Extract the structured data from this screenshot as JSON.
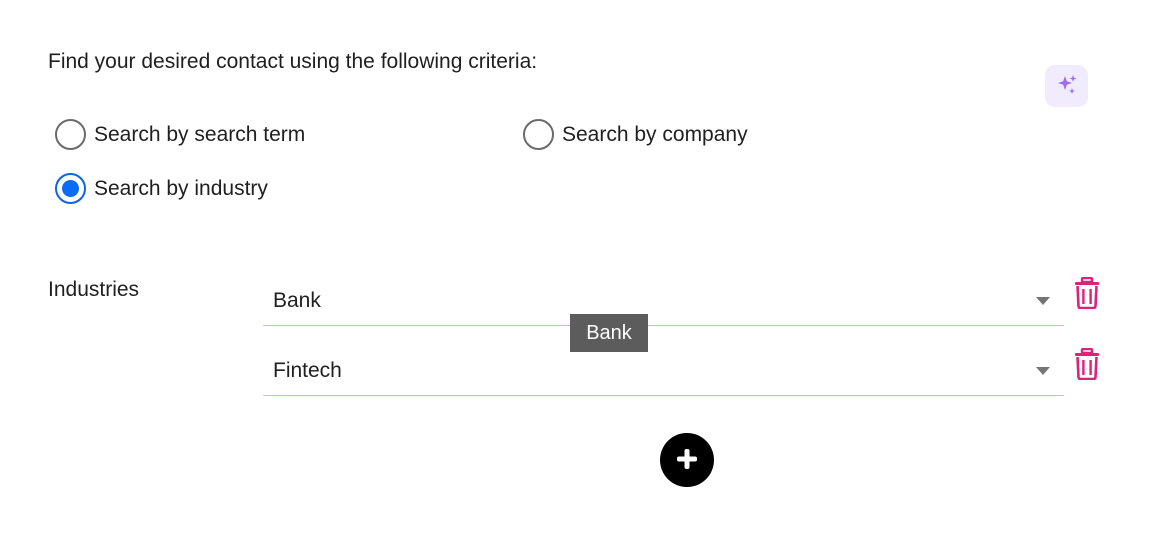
{
  "intro_text": "Find your desired contact using the following criteria:",
  "ai_button": {
    "icon": "sparkles-icon",
    "color": "#9b6cf0",
    "background": "#f1ecfd"
  },
  "search_options": [
    {
      "label": "Search by search term",
      "checked": false
    },
    {
      "label": "Search by company",
      "checked": false
    },
    {
      "label": "Search by industry",
      "checked": true
    }
  ],
  "industries": {
    "label": "Industries",
    "rows": [
      {
        "value": "Bank",
        "delete_icon": "trash-icon"
      },
      {
        "value": "Fintech",
        "delete_icon": "trash-icon"
      }
    ],
    "tooltip": "Bank",
    "add_icon": "plus-icon"
  },
  "colors": {
    "radio_selected": "#0a6cf5",
    "delete_icon": "#e0217a",
    "underline": "#d8b6de",
    "tooltip_bg": "#5c5c5c"
  }
}
